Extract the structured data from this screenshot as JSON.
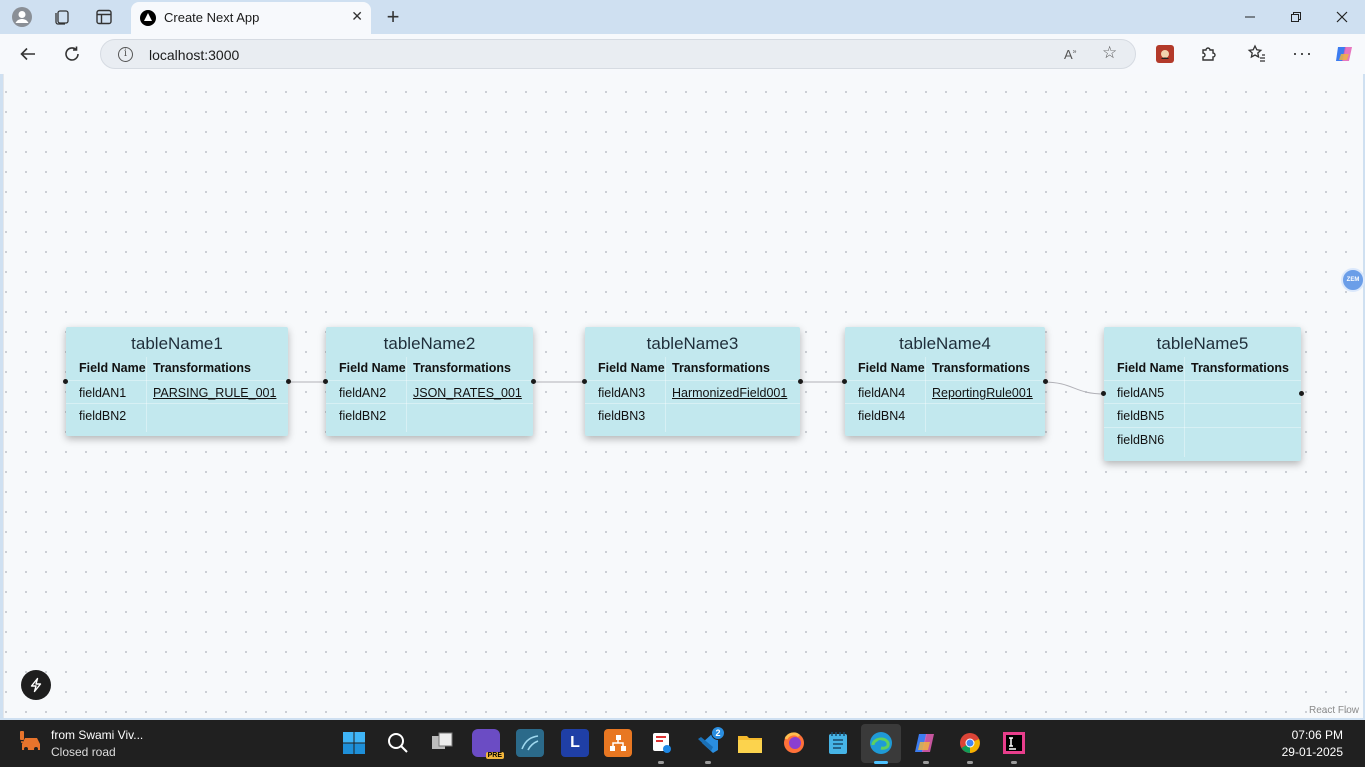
{
  "browser": {
    "tab_title": "Create Next App",
    "url": "localhost:3000"
  },
  "flow": {
    "header_field": "Field Name",
    "header_transform": "Transformations",
    "tables": [
      {
        "name": "tableName1",
        "rows": [
          {
            "field": "fieldAN1",
            "transformation": "PARSING_RULE_001"
          },
          {
            "field": "fieldBN2",
            "transformation": ""
          }
        ]
      },
      {
        "name": "tableName2",
        "rows": [
          {
            "field": "fieldAN2",
            "transformation": "JSON_RATES_001"
          },
          {
            "field": "fieldBN2",
            "transformation": ""
          }
        ]
      },
      {
        "name": "tableName3",
        "rows": [
          {
            "field": "fieldAN3",
            "transformation": "HarmonizedField001"
          },
          {
            "field": "fieldBN3",
            "transformation": ""
          }
        ]
      },
      {
        "name": "tableName4",
        "rows": [
          {
            "field": "fieldAN4",
            "transformation": "ReportingRule001"
          },
          {
            "field": "fieldBN4",
            "transformation": ""
          }
        ]
      },
      {
        "name": "tableName5",
        "rows": [
          {
            "field": "fieldAN5",
            "transformation": ""
          },
          {
            "field": "fieldBN5",
            "transformation": ""
          },
          {
            "field": "fieldBN6",
            "transformation": ""
          }
        ]
      }
    ],
    "edges": [
      {
        "from": "tableName1",
        "to": "tableName2"
      },
      {
        "from": "tableName2",
        "to": "tableName3"
      },
      {
        "from": "tableName3",
        "to": "tableName4"
      },
      {
        "from": "tableName4",
        "to": "tableName5"
      }
    ],
    "badge_label": "ZEM",
    "attribution": "React Flow"
  },
  "taskbar": {
    "weather_title": "from Swami Viv...",
    "weather_subtitle": "Closed road",
    "notification_count": "2",
    "time": "07:06 PM",
    "date": "29-01-2025",
    "apps": [
      "start-icon",
      "search-icon",
      "task-view-icon",
      "power-apps-icon",
      "mysql-workbench-icon",
      "l-app-icon",
      "network-app-icon",
      "snipping-tool-icon",
      "vscode-icon",
      "file-explorer-icon",
      "firefox-icon",
      "notepad-icon",
      "edge-icon",
      "copilot-icon",
      "chrome-icon",
      "intellij-icon"
    ]
  },
  "colors": {
    "node_bg": "#c2e8ee",
    "canvas_bg": "#f7f9fb",
    "tabbar_bg": "#cfe0f1",
    "taskbar_bg": "#202020",
    "accent": "#4cc2ff"
  }
}
